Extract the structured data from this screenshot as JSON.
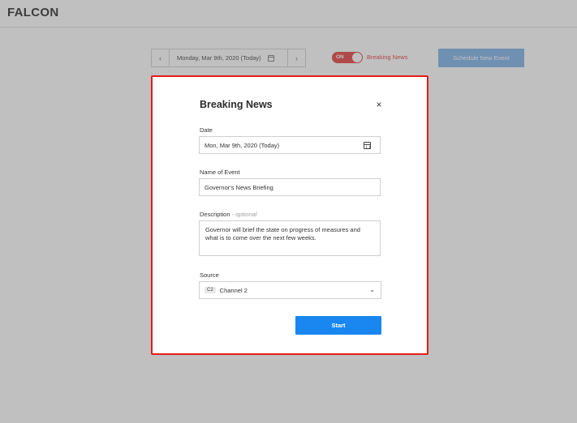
{
  "app": {
    "logo": "FALCON"
  },
  "datebar": {
    "prev": "‹",
    "next": "›",
    "date_text": "Monday, Mar 9th, 2020  (Today)"
  },
  "breaking_toggle": {
    "state_label": "ON",
    "label": "Breaking News",
    "is_on": true
  },
  "schedule_button": {
    "label": "Schedule New Event"
  },
  "modal": {
    "title": "Breaking News",
    "close_symbol": "×",
    "date": {
      "label": "Date",
      "value": "Mon, Mar 9th, 2020 (Today)"
    },
    "name": {
      "label": "Name of Event",
      "value": "Governor's News Briefing"
    },
    "description": {
      "label": "Description",
      "optional_note": "- optional",
      "value": "Governor will brief the state on progress of measures and what is to come over the next few weeks."
    },
    "source": {
      "label": "Source",
      "badge": "C2",
      "value": "Channel 2",
      "chevron": "⌄"
    },
    "start_button": {
      "label": "Start"
    }
  },
  "colors": {
    "accent_blue": "#1a86f0",
    "toggle_red": "#e85050",
    "modal_border": "#e61b1b",
    "schedule_blue": "#8ab8ea"
  }
}
